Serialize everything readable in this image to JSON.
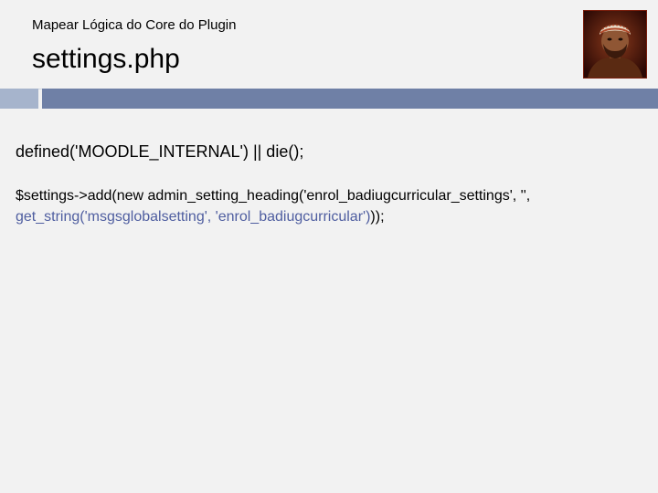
{
  "slide": {
    "subtitle": "Mapear Lógica do Core do Plugin",
    "title": "settings.php"
  },
  "colors": {
    "background": "#f2f2f2",
    "divider_left": "#a6b4cc",
    "divider_right": "#6f80a6",
    "string_call": "#4f5ea0"
  },
  "avatar": {
    "icon": "person-portrait-icon"
  },
  "code": {
    "line1": "defined('MOODLE_INTERNAL') || die();",
    "line2": "$settings->add(new admin_setting_heading('enrol_badiugcurricular_settings', '',",
    "line3_call": "get_string('msgsglobalsetting', 'enrol_badiugcurricular')",
    "line3_tail": "));"
  }
}
